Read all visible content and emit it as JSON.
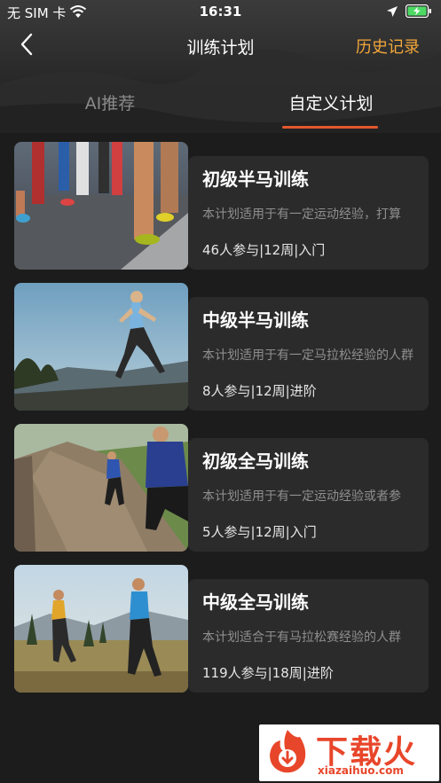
{
  "status_bar": {
    "carrier": "无 SIM 卡",
    "time": "16:31"
  },
  "nav": {
    "title": "训练计划",
    "history_label": "历史记录"
  },
  "tabs": [
    {
      "label": "AI推荐",
      "selected": false
    },
    {
      "label": "自定义计划",
      "selected": true
    }
  ],
  "plans": [
    {
      "title": "初级半马训练",
      "description": "本计划适用于有一定运动经验，打算",
      "meta": "46人参与|12周|入门"
    },
    {
      "title": "中级半马训练",
      "description": "本计划适用于有一定马拉松经验的人群",
      "meta": "8人参与|12周|进阶"
    },
    {
      "title": "初级全马训练",
      "description": "本计划适用于有一定运动经验或者参",
      "meta": "5人参与|12周|入门"
    },
    {
      "title": "中级全马训练",
      "description": "本计划适合于有马拉松赛经验的人群",
      "meta": "119人参与|18周|进阶"
    }
  ],
  "watermark": {
    "text": "下载火",
    "domain": "xiazaihuo.com"
  },
  "colors": {
    "accent_orange": "#f4a73a",
    "tab_underline": "#e4572e",
    "card_bg": "#2b2b2b",
    "page_bg": "#1c1c1c"
  }
}
